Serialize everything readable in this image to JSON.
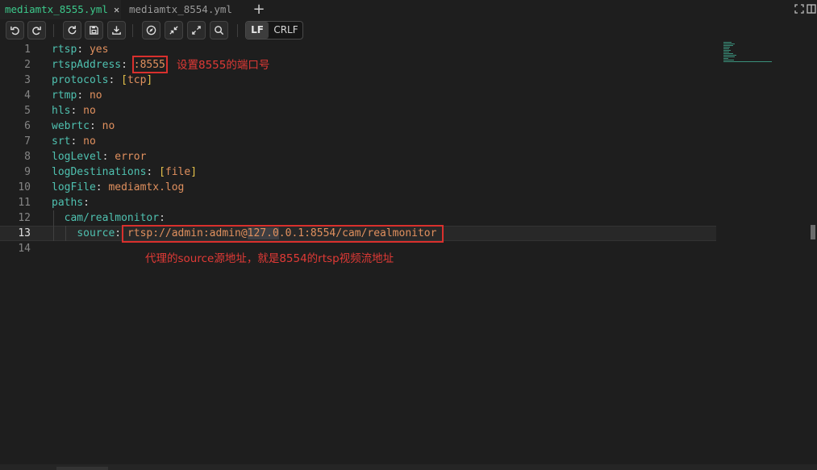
{
  "tabs": [
    {
      "label": "mediamtx_8555.yml",
      "active": true,
      "close_glyph": "✕"
    },
    {
      "label": "mediamtx_8554.yml",
      "active": false
    }
  ],
  "add_tab_glyph": "+",
  "toolbar": {
    "buttons": [
      "undo-icon",
      "redo-icon",
      "reload-icon",
      "save-icon",
      "download-icon",
      "compass-icon",
      "collapse-icon",
      "expand-icon",
      "search-icon"
    ],
    "eol_lf": "LF",
    "eol_crlf": "CRLF",
    "eol_selected": "LF"
  },
  "editor": {
    "current_line": 13,
    "line_numbers": [
      "1",
      "2",
      "3",
      "4",
      "5",
      "6",
      "7",
      "8",
      "9",
      "10",
      "11",
      "12",
      "13",
      "14"
    ],
    "lines": [
      {
        "key": "rtsp",
        "value": "yes"
      },
      {
        "key": "rtspAddress",
        "value": ":8555"
      },
      {
        "key": "protocols",
        "value": "tcp"
      },
      {
        "key": "rtmp",
        "value": "no"
      },
      {
        "key": "hls",
        "value": "no"
      },
      {
        "key": "webrtc",
        "value": "no"
      },
      {
        "key": "srt",
        "value": "no"
      },
      {
        "key": "logLevel",
        "value": "error"
      },
      {
        "key": "logDestinations",
        "value": "file"
      },
      {
        "key": "logFile",
        "value": "mediamtx.log"
      },
      {
        "key": "paths"
      },
      {
        "key": "cam/realmonitor"
      },
      {
        "key": "source",
        "value_a": "rtsp://admin:admin@",
        "value_hl": "127.0",
        "value_b": ".0.1:8554/cam/realmonitor"
      }
    ]
  },
  "annotations": {
    "port_note": "设置8555的端口号",
    "source_note": "代理的source源地址，就是8554的rtsp视频流地址"
  },
  "colors": {
    "active_tab": "#3cc98b",
    "key": "#4fc1b0",
    "value": "#e0905e",
    "bracket": "#e6c24a",
    "annotation": "#d9302d"
  }
}
